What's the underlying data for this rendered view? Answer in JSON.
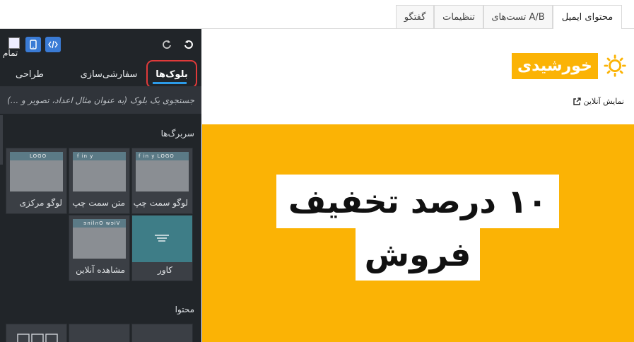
{
  "top_tabs": [
    "محتوای ایمیل",
    "تست‌های A/B",
    "تنظیمات",
    "گفتگو"
  ],
  "panel": {
    "image_alt": "تمام",
    "tabs": [
      "بلوک‌ها",
      "سفارشی‌سازی",
      "طراحی"
    ],
    "active_tab": "بلوک‌ها",
    "search_placeholder": "جستجوی یک بلوک (به عنوان مثال اعداد، تصویر و ...)",
    "sections": {
      "headers_title": "سربرگ‌ها",
      "content_title": "محتوا"
    },
    "header_blocks": [
      {
        "label": "لوگو مرکزی",
        "mini": "LOGO"
      },
      {
        "label": "متن سمت چپ",
        "mini": "f in y"
      },
      {
        "label": "لوگو سمت چپ",
        "mini": "f in y  LOGO"
      }
    ],
    "other_blocks": [
      {
        "label": "مشاهده آنلاین",
        "mini": "View Online"
      },
      {
        "label": "کاور"
      }
    ]
  },
  "preview": {
    "brand_name": "خورشیدی",
    "view_online": "نمایش آنلاین",
    "headline_line1": "۱۰ درصد تخفیف",
    "headline_line2": "فروش",
    "accent_color": "#fbb305"
  }
}
